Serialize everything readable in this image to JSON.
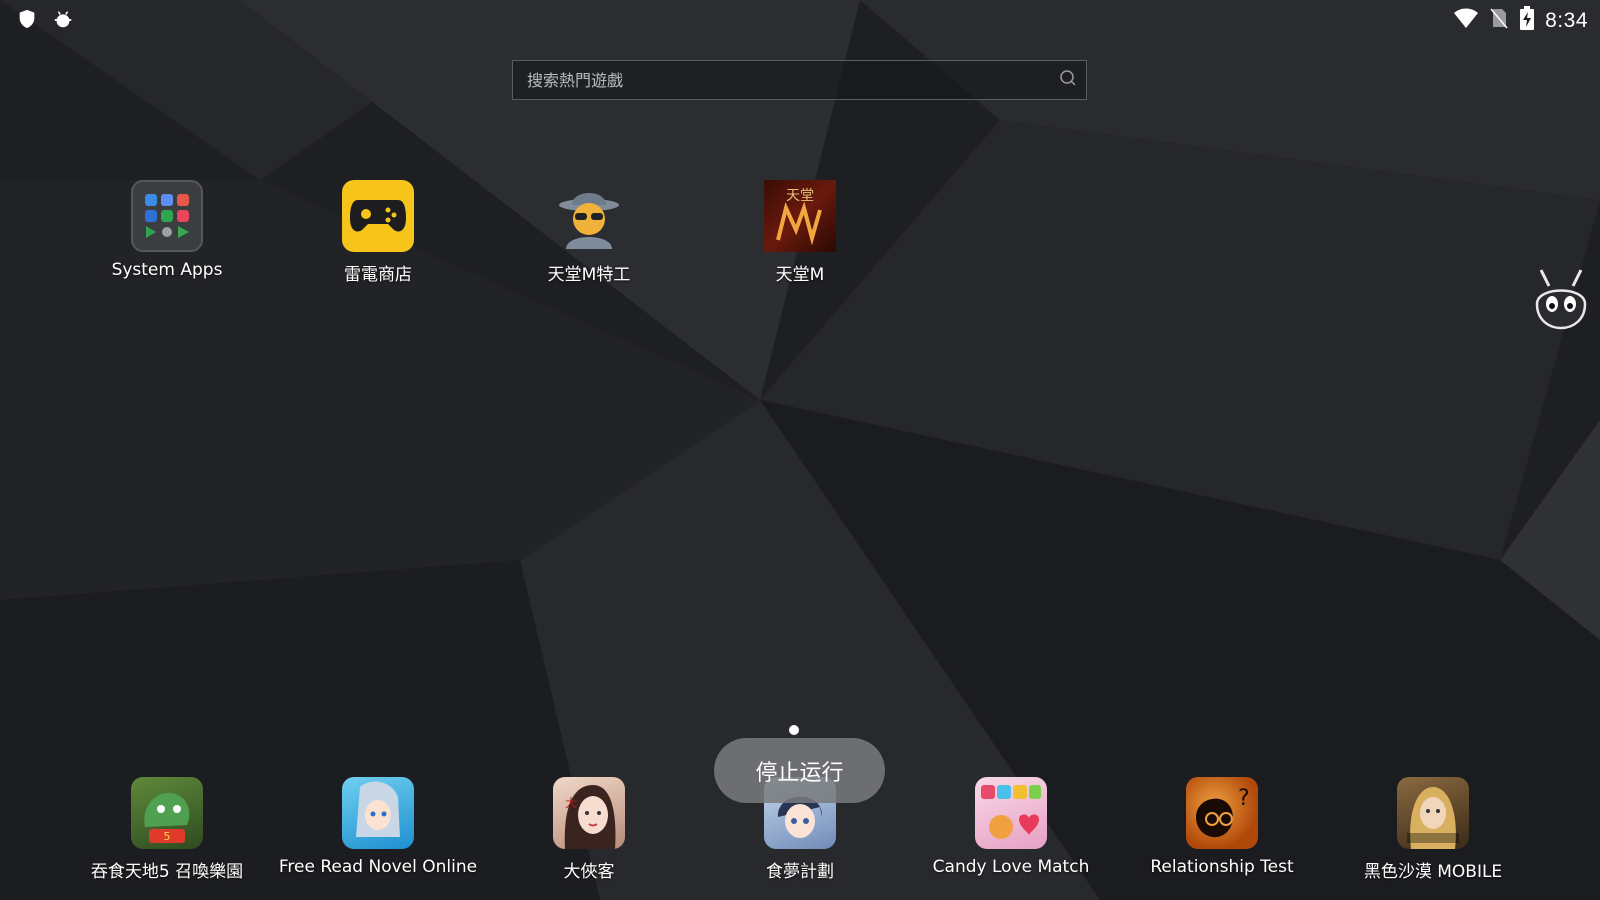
{
  "status_bar": {
    "time": "8:34",
    "left_icons": [
      "shield-icon",
      "android-debug-icon"
    ],
    "right_icons": [
      "wifi-icon",
      "no-sim-icon",
      "battery-charging-icon"
    ]
  },
  "search": {
    "placeholder": "搜索熱門遊戲"
  },
  "home_apps": [
    {
      "label": "System Apps",
      "icon": "folder-icon"
    },
    {
      "label": "雷電商店",
      "icon": "gamepad-store-icon"
    },
    {
      "label": "天堂M特工",
      "icon": "spy-agent-icon"
    },
    {
      "label": "天堂M",
      "icon": "lineage-m-icon"
    }
  ],
  "dock_apps": [
    {
      "label": "吞食天地5 召喚樂園",
      "icon": "dragon-game-icon"
    },
    {
      "label": "Free Read Novel Online",
      "icon": "anime-girl-icon"
    },
    {
      "label": "大俠客",
      "icon": "wuxia-girl-icon"
    },
    {
      "label": "食夢計劃",
      "icon": "anime-boy-icon"
    },
    {
      "label": "Candy Love Match",
      "icon": "candy-match-icon"
    },
    {
      "label": "Relationship Test",
      "icon": "relationship-test-icon"
    },
    {
      "label": "黑色沙漠 MOBILE",
      "icon": "black-desert-icon"
    }
  ],
  "toast": {
    "text": "停止运行"
  },
  "pager": {
    "page_count": 1,
    "current_page": 1
  },
  "floating_assistant": {
    "icon": "mascot-icon"
  },
  "colors": {
    "background": "#1f2023",
    "store_yellow": "#f7c41b",
    "toast_bg": "#7a7c80"
  }
}
